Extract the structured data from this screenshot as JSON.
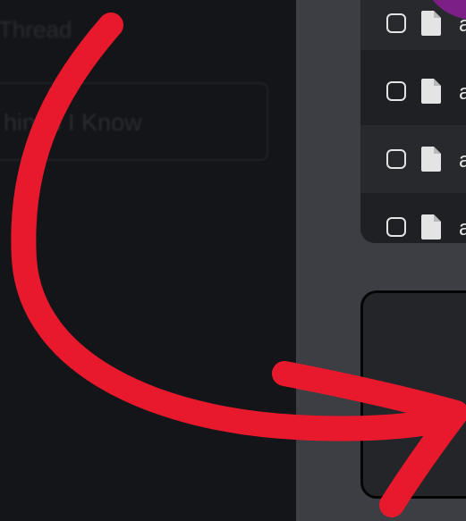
{
  "sidebar": {
    "thread_label": "Thread",
    "input_value": "hings I Know"
  },
  "file_list": {
    "rows": [
      {
        "name": "a",
        "checked": false,
        "icon": "document-icon"
      },
      {
        "name": "a",
        "checked": false,
        "icon": "document-icon"
      },
      {
        "name": "a",
        "checked": false,
        "icon": "document-icon"
      },
      {
        "name": "a",
        "checked": false,
        "icon": "document-icon"
      }
    ]
  },
  "annotation": {
    "arrow_color": "#e8192c",
    "accent_purple": "#7c1f86"
  }
}
